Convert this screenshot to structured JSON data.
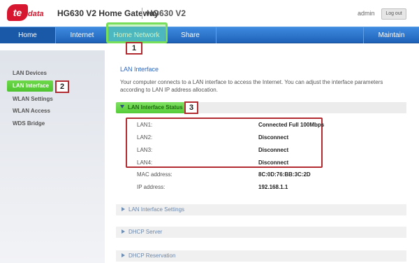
{
  "header": {
    "logo_te": "te",
    "logo_data": "data",
    "product_title": "HG630 V2 Home Gateway",
    "model": "HG630 V2",
    "user": "admin",
    "logout_label": "Log out"
  },
  "nav": {
    "items": [
      {
        "label": "Home"
      },
      {
        "label": "Internet"
      },
      {
        "label": "Home Network"
      },
      {
        "label": "Share"
      },
      {
        "label": "Maintain"
      }
    ],
    "active": "Home Network"
  },
  "sidebar": {
    "items": [
      {
        "label": "LAN Devices"
      },
      {
        "label": "LAN Interface"
      },
      {
        "label": "WLAN Settings"
      },
      {
        "label": "WLAN Access"
      },
      {
        "label": "WDS Bridge"
      }
    ],
    "active": "LAN Interface"
  },
  "main": {
    "section_title": "LAN Interface",
    "description": "Your computer connects to a LAN interface to access the Internet. You can adjust the interface parameters according to LAN IP address allocation.",
    "status_header": "LAN Interface Status",
    "rows": [
      {
        "label": "LAN1:",
        "value": "Connected Full 100Mbps"
      },
      {
        "label": "LAN2:",
        "value": "Disconnect"
      },
      {
        "label": "LAN3:",
        "value": "Disconnect"
      },
      {
        "label": "LAN4:",
        "value": "Disconnect"
      },
      {
        "label": "MAC address:",
        "value": "8C:0D:76:BB:3C:2D"
      },
      {
        "label": "IP address:",
        "value": "192.168.1.1"
      }
    ],
    "collapsed_sections": [
      {
        "label": "LAN Interface Settings"
      },
      {
        "label": "DHCP Server"
      },
      {
        "label": "DHCP Reservation"
      }
    ]
  },
  "annotations": {
    "step1": "1",
    "step2": "2",
    "step3": "3"
  },
  "colors": {
    "nav_blue": "#1e62b8",
    "highlight_green": "#6dd84a",
    "callout_red": "#b12b31",
    "brand_red": "#d7172f"
  }
}
